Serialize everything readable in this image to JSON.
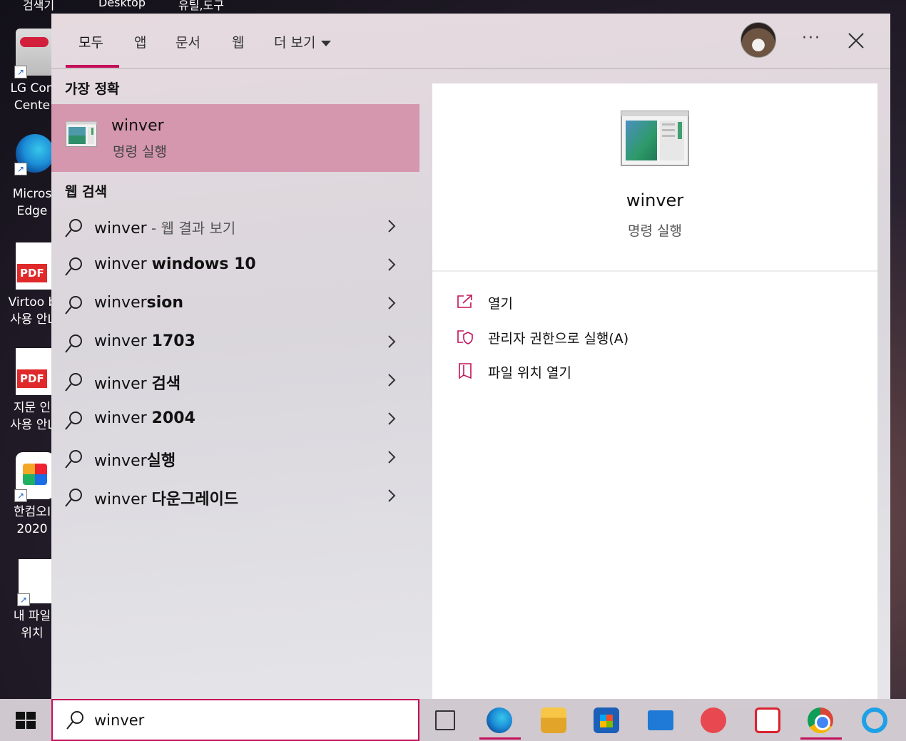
{
  "desktop": {
    "top_labels": [
      "검색기",
      "Desktop",
      "유틸,도구"
    ],
    "icons": [
      {
        "label_line1": "LG Con",
        "label_line2": "Cente"
      },
      {
        "label_line1": "Micros",
        "label_line2": "Edge"
      },
      {
        "label_line1": "Virtoo b",
        "label_line2": "사용 안L"
      },
      {
        "label_line1": "지문 인",
        "label_line2": "사용 안L"
      },
      {
        "label_line1": "한컴오I",
        "label_line2": "2020"
      },
      {
        "label_line1": "내 파일",
        "label_line2": "위치"
      }
    ]
  },
  "search_panel": {
    "tabs": [
      {
        "label": "모두",
        "active": true
      },
      {
        "label": "앱"
      },
      {
        "label": "문서"
      },
      {
        "label": "웹"
      },
      {
        "label": "더 보기"
      }
    ],
    "more_options": "···",
    "best_match": {
      "heading": "가장 정확",
      "name": "winver",
      "type": "명령 실행"
    },
    "web_search": {
      "heading": "웹 검색",
      "items": [
        {
          "prefix": "winver",
          "bold": "",
          "suffix": " - 웹 결과 보기"
        },
        {
          "prefix": "winver ",
          "bold": "windows 10",
          "suffix": ""
        },
        {
          "prefix": "winver",
          "bold": "sion",
          "suffix": ""
        },
        {
          "prefix": "winver ",
          "bold": "1703",
          "suffix": ""
        },
        {
          "prefix": "winver ",
          "bold": "검색",
          "suffix": ""
        },
        {
          "prefix": "winver ",
          "bold": "2004",
          "suffix": ""
        },
        {
          "prefix": "winver",
          "bold": "실행",
          "suffix": ""
        },
        {
          "prefix": "winver ",
          "bold": "다운그레이드",
          "suffix": ""
        }
      ]
    },
    "preview": {
      "name": "winver",
      "type": "명령 실행",
      "actions": [
        {
          "label": "열기",
          "icon": "open-icon"
        },
        {
          "label": "관리자 권한으로 실행(A)",
          "icon": "shield-icon"
        },
        {
          "label": "파일 위치 열기",
          "icon": "folder-location-icon"
        }
      ]
    }
  },
  "taskbar": {
    "search_value": "winver",
    "apps": [
      "task-view",
      "edge",
      "file-explorer",
      "microsoft-store",
      "mail",
      "chatbot",
      "sync",
      "chrome",
      "internet-explorer"
    ]
  },
  "colors": {
    "accent": "#c3105a",
    "best_match_bg": "#d597ad"
  }
}
